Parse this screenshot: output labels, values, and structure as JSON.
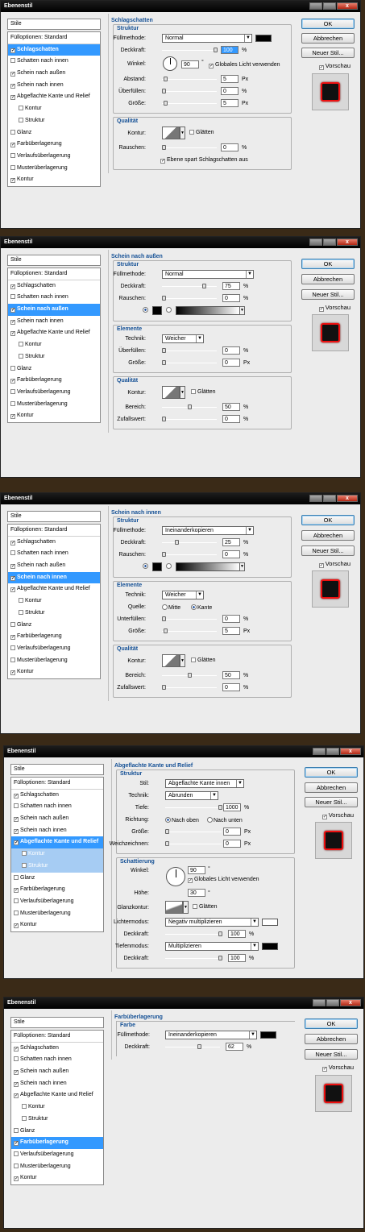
{
  "title": "Ebenenstil",
  "close": "x",
  "stile": "Stile",
  "fuell": "Fülloptionen: Standard",
  "list": [
    "Schlagschatten",
    "Schatten nach innen",
    "Schein nach außen",
    "Schein nach innen",
    "Abgeflachte Kante und Relief",
    "Kontur",
    "Struktur",
    "Glanz",
    "Farbüberlagerung",
    "Verlaufsüberlagerung",
    "Musterüberlagerung",
    "Kontur"
  ],
  "checks": [
    true,
    false,
    true,
    true,
    true,
    false,
    false,
    false,
    true,
    false,
    false,
    true
  ],
  "buttons": {
    "ok": "OK",
    "cancel": "Abbrechen",
    "new": "Neuer Stil...",
    "preview": "Vorschau"
  },
  "common": {
    "struktur": "Struktur",
    "qualitaet": "Qualität",
    "elemente": "Elemente",
    "fuellmethode": "Füllmethode:",
    "deckkraft": "Deckkraft:",
    "rauschen": "Rauschen:",
    "kontur": "Kontur:",
    "glaetten": "Glätten",
    "technik": "Technik:",
    "groesse": "Größe:",
    "px": "Px",
    "pct": "%",
    "bereich": "Bereich:",
    "zufall": "Zufallswert:"
  },
  "d1": {
    "title": "Schlagschatten",
    "mode": "Normal",
    "opacity": "100",
    "angle_label": "Winkel:",
    "angle": "90",
    "global": "Globales Licht verwenden",
    "dist_label": "Abstand:",
    "dist": "5",
    "spread_label": "Überfüllen:",
    "spread": "0",
    "size": "5",
    "noise": "0",
    "knockout": "Ebene spart Schlagschatten aus"
  },
  "d2": {
    "title": "Schein nach außen",
    "mode": "Normal",
    "opacity": "75",
    "noise": "0",
    "tech": "Weicher",
    "spread_label": "Überfüllen:",
    "spread": "0",
    "size": "0",
    "range": "50",
    "jitter": "0"
  },
  "d3": {
    "title": "Schein nach innen",
    "mode": "Ineinanderkopieren",
    "opacity": "25",
    "noise": "0",
    "tech": "Weicher",
    "source_label": "Quelle:",
    "src1": "Mitte",
    "src2": "Kante",
    "choke_label": "Unterfüllen:",
    "choke": "0",
    "size": "5",
    "range": "50",
    "jitter": "0"
  },
  "d4": {
    "title": "Abgeflachte Kante und Relief",
    "stil_label": "Stil:",
    "stil": "Abgeflachte Kante innen",
    "tech": "Abrunden",
    "depth_label": "Tiefe:",
    "depth": "1000",
    "dir_label": "Richtung:",
    "up": "Nach oben",
    "down": "Nach unten",
    "size": "0",
    "soften_label": "Weichzeichnen:",
    "soften": "0",
    "shading": "Schattierung",
    "angle_label": "Winkel:",
    "angle": "90",
    "global": "Globales Licht verwenden",
    "alt_label": "Höhe:",
    "alt": "30",
    "gloss_label": "Glanzkontur:",
    "hl_label": "Lichtermodus:",
    "hl_mode": "Negativ multiplizieren",
    "hl_op": "100",
    "sh_label": "Tiefenmodus:",
    "sh_mode": "Multiplizieren",
    "sh_op": "100"
  },
  "d5": {
    "title": "Farbüberlagerung",
    "farbe": "Farbe",
    "mode": "Ineinanderkopieren",
    "opacity": "62"
  }
}
